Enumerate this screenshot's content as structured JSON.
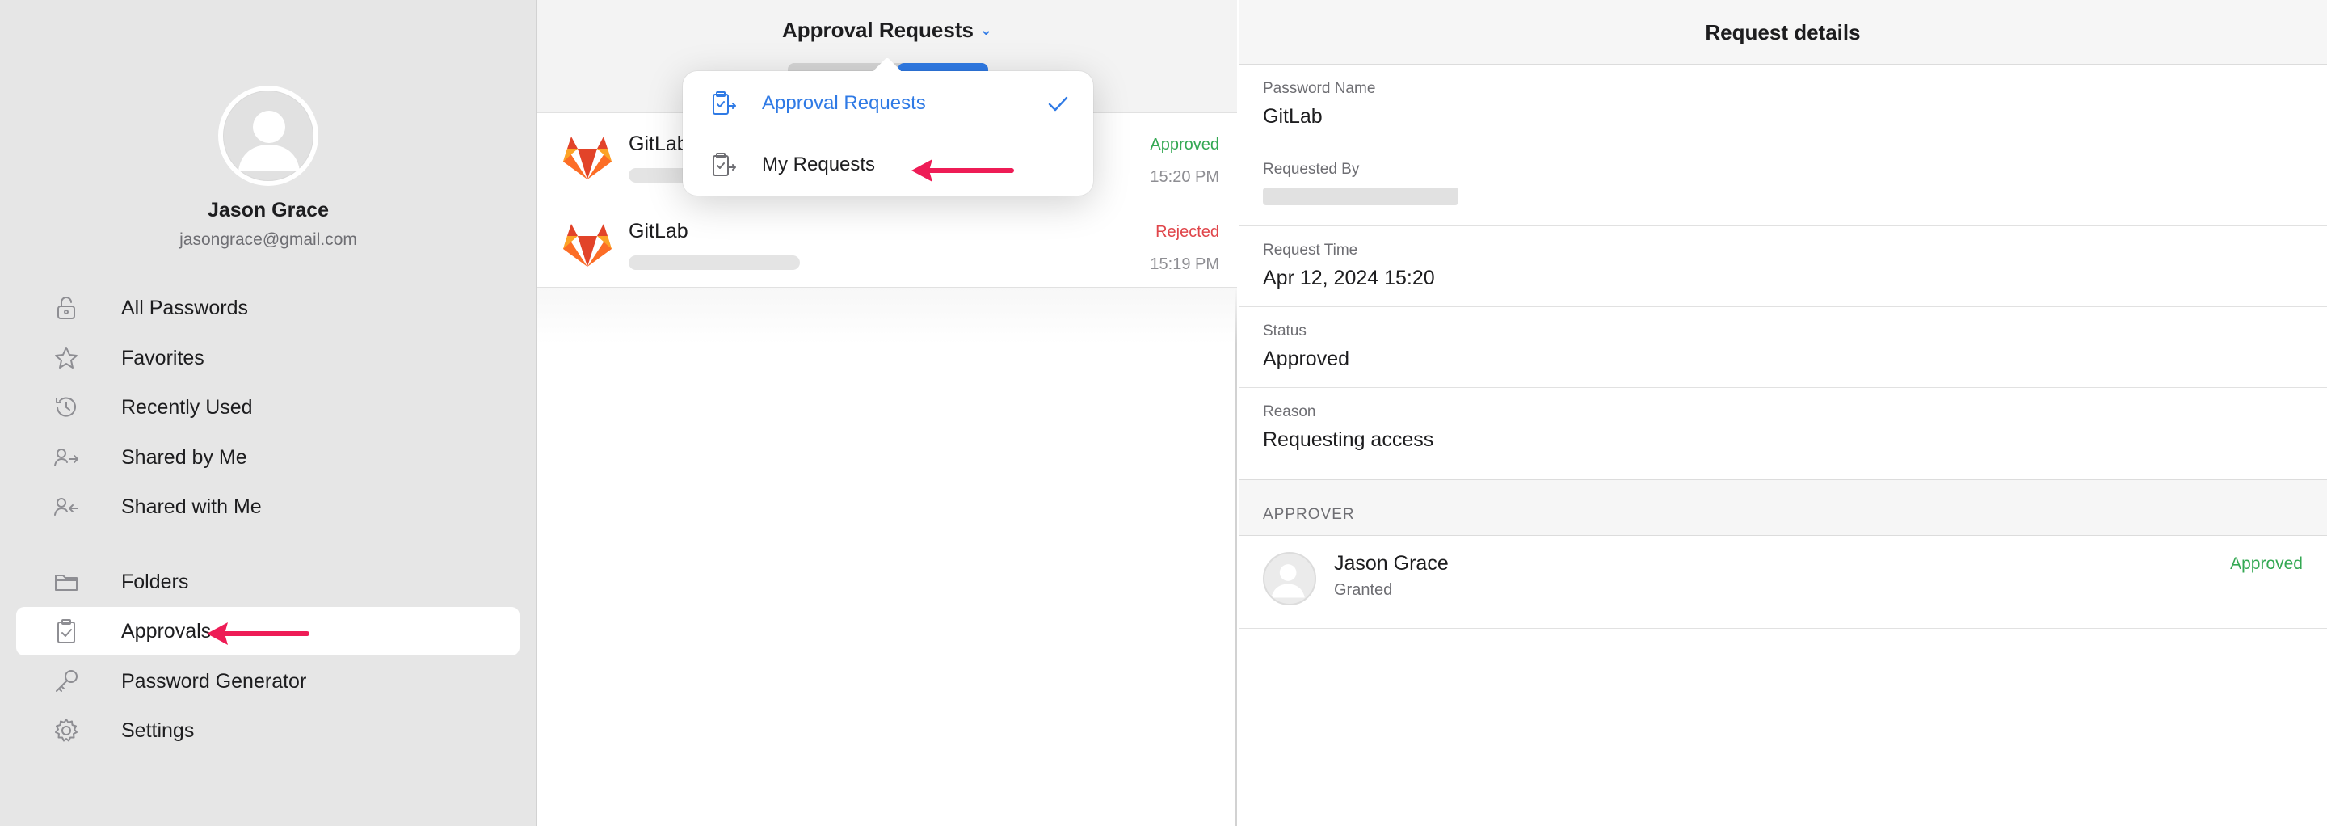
{
  "profile": {
    "name": "Jason Grace",
    "email": "jasongrace@gmail.com"
  },
  "sidebar": {
    "items": [
      {
        "label": "All Passwords",
        "icon": "lock-icon"
      },
      {
        "label": "Favorites",
        "icon": "star-icon"
      },
      {
        "label": "Recently Used",
        "icon": "history-icon"
      },
      {
        "label": "Shared by Me",
        "icon": "share-out-icon"
      },
      {
        "label": "Shared with Me",
        "icon": "share-in-icon"
      },
      {
        "label": "Folders",
        "icon": "folder-icon"
      },
      {
        "label": "Approvals",
        "icon": "clipboard-check-icon",
        "active": true
      },
      {
        "label": "Password Generator",
        "icon": "key-icon"
      },
      {
        "label": "Settings",
        "icon": "gear-icon"
      }
    ]
  },
  "list": {
    "title": "Approval Requests",
    "rows": [
      {
        "name": "GitLab",
        "status": "Approved",
        "time": "15:20 PM"
      },
      {
        "name": "GitLab",
        "status": "Rejected",
        "time": "15:19 PM"
      }
    ]
  },
  "dropdown": {
    "items": [
      {
        "label": "Approval Requests",
        "selected": true
      },
      {
        "label": "My Requests",
        "selected": false
      }
    ]
  },
  "details": {
    "title": "Request details",
    "fields": [
      {
        "label": "Password Name",
        "value": "GitLab"
      },
      {
        "label": "Requested By",
        "value": ""
      },
      {
        "label": "Request Time",
        "value": "Apr 12, 2024 15:20"
      },
      {
        "label": "Status",
        "value": "Approved"
      },
      {
        "label": "Reason",
        "value": "Requesting access"
      }
    ],
    "approver_section": "APPROVER",
    "approver": {
      "name": "Jason Grace",
      "sub": "Granted",
      "status": "Approved"
    }
  },
  "colors": {
    "accent": "#2f7ae5",
    "approved": "#34a853",
    "rejected": "#e0464b",
    "annotation_arrow": "#ee1c56",
    "gitlab_orange": "#e24329"
  }
}
